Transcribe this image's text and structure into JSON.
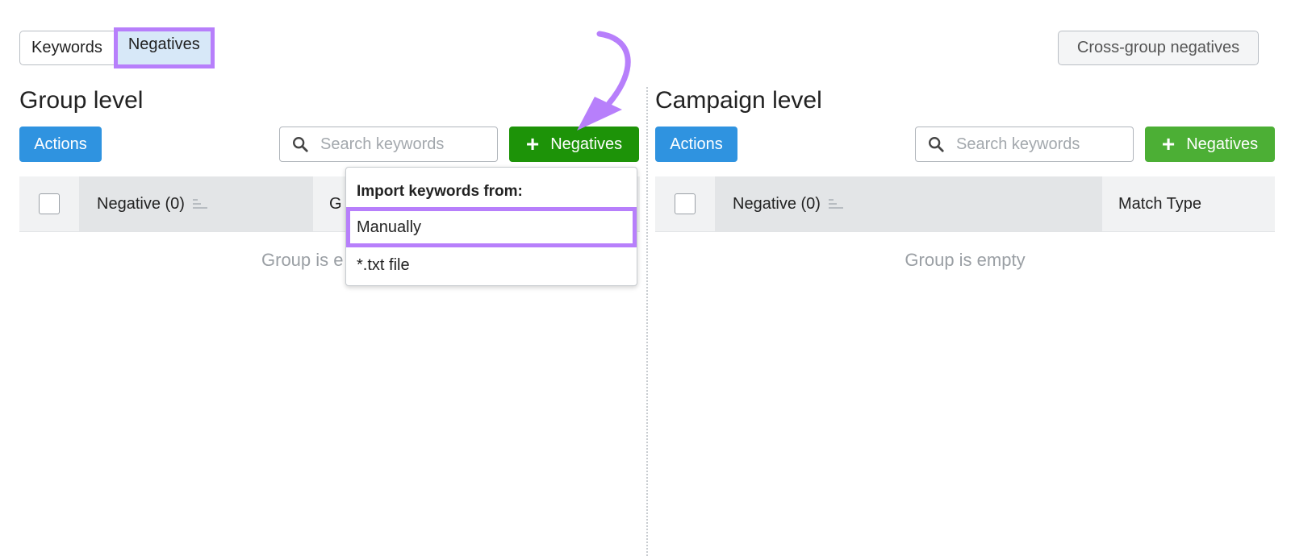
{
  "tabs": [
    {
      "label": "Keywords",
      "active": false
    },
    {
      "label": "Negatives",
      "active": true
    }
  ],
  "cross_group_button": "Cross-group negatives",
  "group_level": {
    "title": "Group level",
    "actions_label": "Actions",
    "search_placeholder": "Search keywords",
    "add_negatives_label": "Negatives",
    "columns": [
      "Negative (0)",
      "G"
    ],
    "empty_text": "Group is e",
    "button_color": "#1d9308"
  },
  "campaign_level": {
    "title": "Campaign level",
    "actions_label": "Actions",
    "search_placeholder": "Search keywords",
    "add_negatives_label": "Negatives",
    "columns": [
      "Negative (0)",
      "Match Type"
    ],
    "empty_text": "Group is empty",
    "button_color": "#4caf35"
  },
  "import_dropdown": {
    "title": "Import keywords from:",
    "items": [
      "Manually",
      "*.txt file"
    ],
    "highlighted": "Manually"
  },
  "annotation": {
    "highlight_color": "#b77ffb",
    "arrow": "arrow pointing to add negatives button"
  }
}
